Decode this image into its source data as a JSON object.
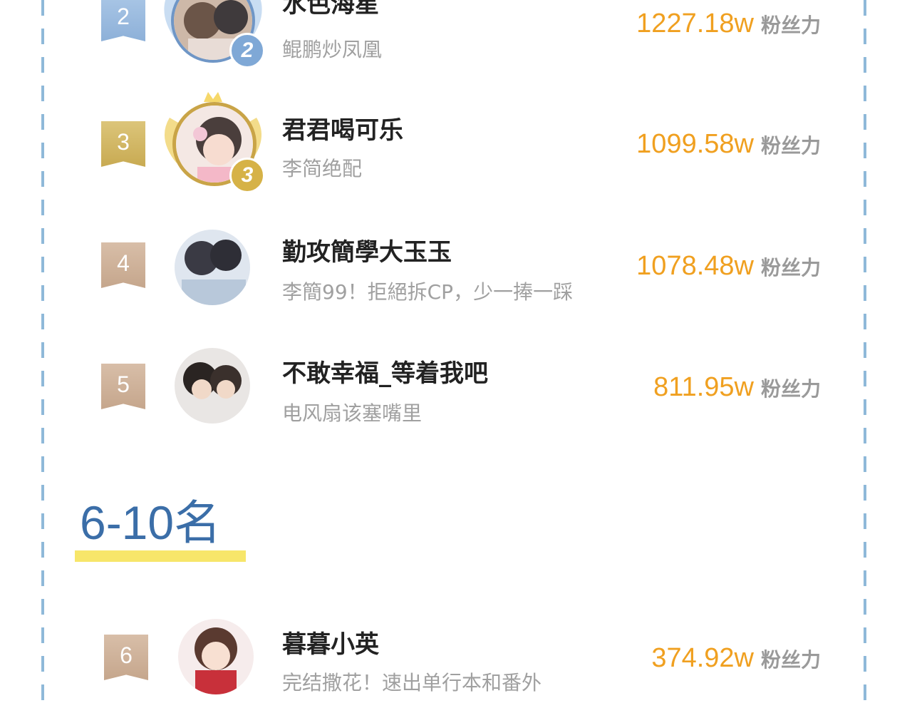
{
  "colors": {
    "accent_blue": "#3b6ea8",
    "score_orange": "#f0a020",
    "underline_yellow": "#f7e66a",
    "dashed_border": "#8fb9d9"
  },
  "rankings": [
    {
      "rank": "2",
      "crown_number": "2",
      "name": "水色海星",
      "subtitle": "鲲鹏炒凤凰",
      "score": "1227.18w",
      "unit": "粉丝力"
    },
    {
      "rank": "3",
      "crown_number": "3",
      "name": "君君喝可乐",
      "subtitle": "李简绝配",
      "score": "1099.58w",
      "unit": "粉丝力"
    },
    {
      "rank": "4",
      "name": "勤攻簡學大玉玉",
      "subtitle": "李簡99！拒絕拆CP，少一捧一踩",
      "score": "1078.48w",
      "unit": "粉丝力"
    },
    {
      "rank": "5",
      "name": "不敢幸福_等着我吧",
      "subtitle": "电风扇该塞嘴里",
      "score": "811.95w",
      "unit": "粉丝力"
    }
  ],
  "section": {
    "title": "6-10名"
  },
  "rankings_6_10": [
    {
      "rank": "6",
      "name": "暮暮小英",
      "subtitle": "完结撒花！速出单行本和番外",
      "score": "374.92w",
      "unit": "粉丝力"
    }
  ],
  "icons": [
    "rank-badge-icon",
    "avatar-frame-wings-icon",
    "crown-icon"
  ]
}
